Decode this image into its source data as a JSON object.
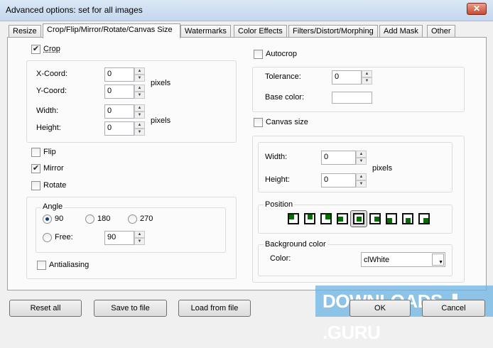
{
  "window": {
    "title": "Advanced options: set for all images",
    "close": "✕"
  },
  "tabs": [
    "Resize",
    "Crop/Flip/Mirror/Rotate/Canvas Size",
    "Watermarks",
    "Color Effects",
    "Filters/Distort/Morphing",
    "Add Mask",
    "Other"
  ],
  "crop": {
    "label": "Crop",
    "checked": true,
    "x_label": "X-Coord:",
    "x": "0",
    "y_label": "Y-Coord:",
    "y": "0",
    "width_label": "Width:",
    "width": "0",
    "height_label": "Height:",
    "height": "0",
    "units": "pixels"
  },
  "flip": {
    "label": "Flip",
    "checked": false
  },
  "mirror": {
    "label": "Mirror",
    "checked": true
  },
  "rotate": {
    "label": "Rotate",
    "checked": false,
    "angle_title": "Angle",
    "opt90": "90",
    "opt180": "180",
    "opt270": "270",
    "free": "Free:",
    "free_value": "90",
    "antialiasing": "Antialiasing"
  },
  "autocrop": {
    "label": "Autocrop",
    "tolerance_label": "Tolerance:",
    "tolerance": "0",
    "base_color_label": "Base color:"
  },
  "canvas": {
    "label": "Canvas size",
    "width_label": "Width:",
    "width": "0",
    "height_label": "Height:",
    "height": "0",
    "units": "pixels",
    "position_title": "Position",
    "bg_title": "Background color",
    "color_label": "Color:",
    "color_value": "clWhite"
  },
  "buttons": {
    "reset": "Reset all",
    "save": "Save to file",
    "load": "Load from file",
    "ok": "OK",
    "cancel": "Cancel"
  },
  "watermark": "DOWNLOADS ⬇ .GURU"
}
